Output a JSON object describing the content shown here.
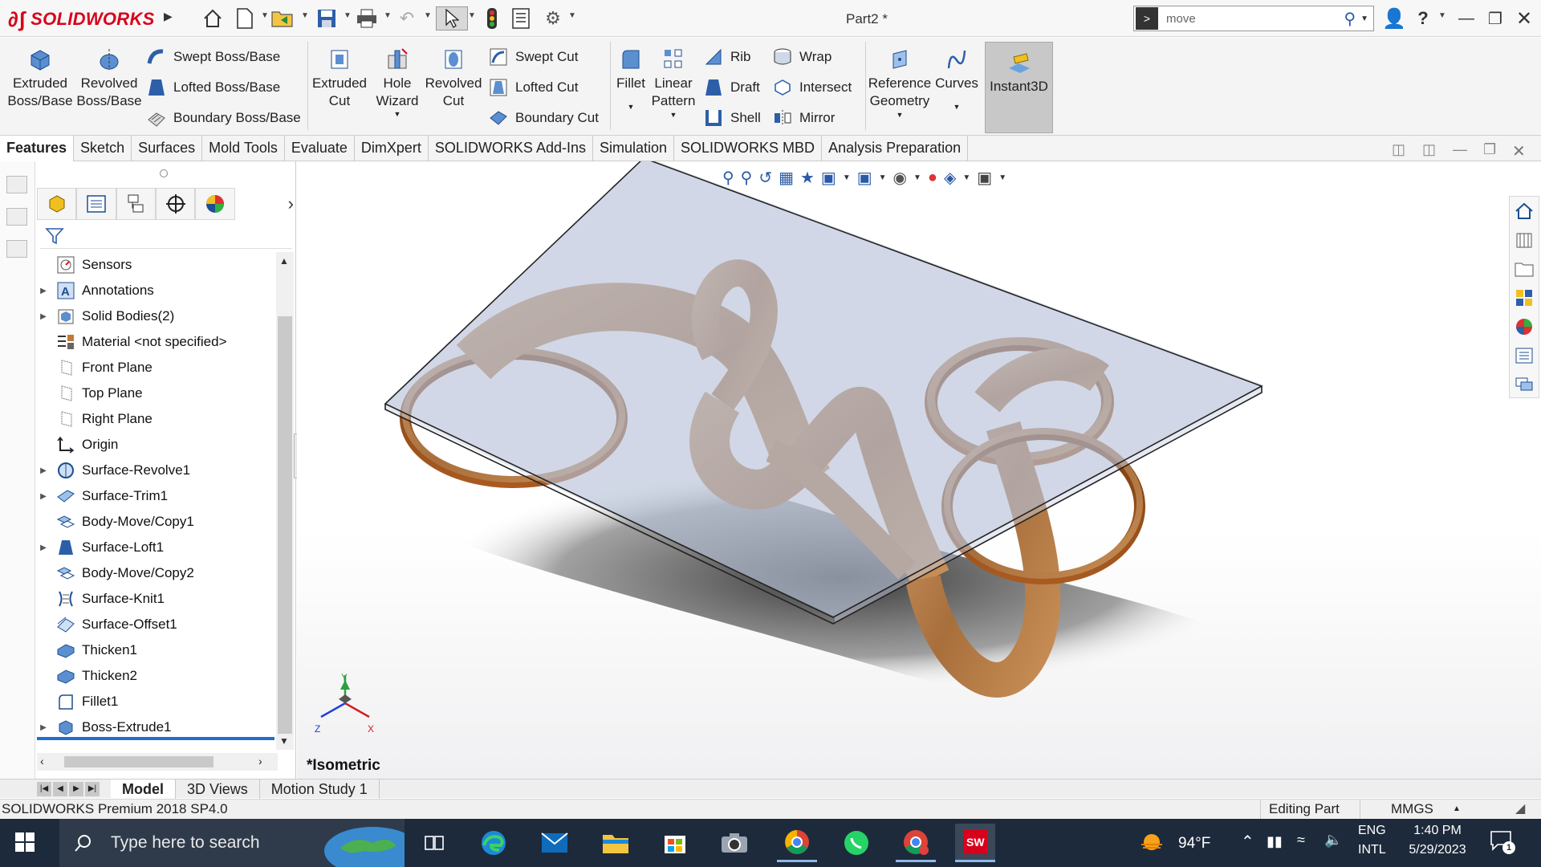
{
  "app": {
    "logo_text": "SOLIDWORKS",
    "document_title": "Part2 *",
    "search_value": "move"
  },
  "ribbon": {
    "extruded_boss": "Extruded Boss/Base",
    "revolved_boss": "Revolved Boss/Base",
    "swept_boss": "Swept Boss/Base",
    "lofted_boss": "Lofted Boss/Base",
    "boundary_boss": "Boundary Boss/Base",
    "extruded_cut": "Extruded Cut",
    "hole_wizard": "Hole Wizard",
    "revolved_cut": "Revolved Cut",
    "swept_cut": "Swept Cut",
    "lofted_cut": "Lofted Cut",
    "boundary_cut": "Boundary Cut",
    "fillet": "Fillet",
    "linear_pattern": "Linear Pattern",
    "rib": "Rib",
    "draft": "Draft",
    "shell": "Shell",
    "wrap": "Wrap",
    "intersect": "Intersect",
    "mirror": "Mirror",
    "reference_geometry": "Reference Geometry",
    "curves": "Curves",
    "instant3d": "Instant3D"
  },
  "command_tabs": [
    "Features",
    "Sketch",
    "Surfaces",
    "Mold Tools",
    "Evaluate",
    "DimXpert",
    "SOLIDWORKS Add-Ins",
    "Simulation",
    "SOLIDWORKS MBD",
    "Analysis Preparation"
  ],
  "feature_tree": [
    {
      "label": "Sensors",
      "icon": "sensor-icon",
      "expandable": false
    },
    {
      "label": "Annotations",
      "icon": "annotation-icon",
      "expandable": true
    },
    {
      "label": "Solid Bodies(2)",
      "icon": "solid-bodies-icon",
      "expandable": true
    },
    {
      "label": "Material <not specified>",
      "icon": "material-icon",
      "expandable": false
    },
    {
      "label": "Front Plane",
      "icon": "plane-icon",
      "expandable": false
    },
    {
      "label": "Top Plane",
      "icon": "plane-icon",
      "expandable": false
    },
    {
      "label": "Right Plane",
      "icon": "plane-icon",
      "expandable": false
    },
    {
      "label": "Origin",
      "icon": "origin-icon",
      "expandable": false
    },
    {
      "label": "Surface-Revolve1",
      "icon": "surface-revolve-icon",
      "expandable": true
    },
    {
      "label": "Surface-Trim1",
      "icon": "surface-trim-icon",
      "expandable": true
    },
    {
      "label": "Body-Move/Copy1",
      "icon": "move-copy-icon",
      "expandable": false
    },
    {
      "label": "Surface-Loft1",
      "icon": "surface-loft-icon",
      "expandable": true
    },
    {
      "label": "Body-Move/Copy2",
      "icon": "move-copy-icon",
      "expandable": false
    },
    {
      "label": "Surface-Knit1",
      "icon": "surface-knit-icon",
      "expandable": false
    },
    {
      "label": "Surface-Offset1",
      "icon": "surface-offset-icon",
      "expandable": false
    },
    {
      "label": "Thicken1",
      "icon": "thicken-icon",
      "expandable": false
    },
    {
      "label": "Thicken2",
      "icon": "thicken-icon",
      "expandable": false
    },
    {
      "label": "Fillet1",
      "icon": "fillet-icon",
      "expandable": false
    },
    {
      "label": "Boss-Extrude1",
      "icon": "extrude-icon",
      "expandable": true
    }
  ],
  "viewport": {
    "view_name": "*Isometric",
    "axis_x": "X",
    "axis_y": "Y",
    "axis_z": "Z"
  },
  "bottom_tabs": [
    "Model",
    "3D Views",
    "Motion Study 1"
  ],
  "status": {
    "version": "SOLIDWORKS Premium 2018 SP4.0",
    "mode": "Editing Part",
    "units": "MMGS"
  },
  "taskbar": {
    "search_placeholder": "Type here to search",
    "temperature": "94°F",
    "lang_line1": "ENG",
    "lang_line2": "INTL",
    "time": "1:40 PM",
    "date": "5/29/2023",
    "notification_count": "1"
  },
  "colors": {
    "brand_red": "#d9001b",
    "wood": "#b27a45",
    "taskbar": "#1d2a3b"
  }
}
